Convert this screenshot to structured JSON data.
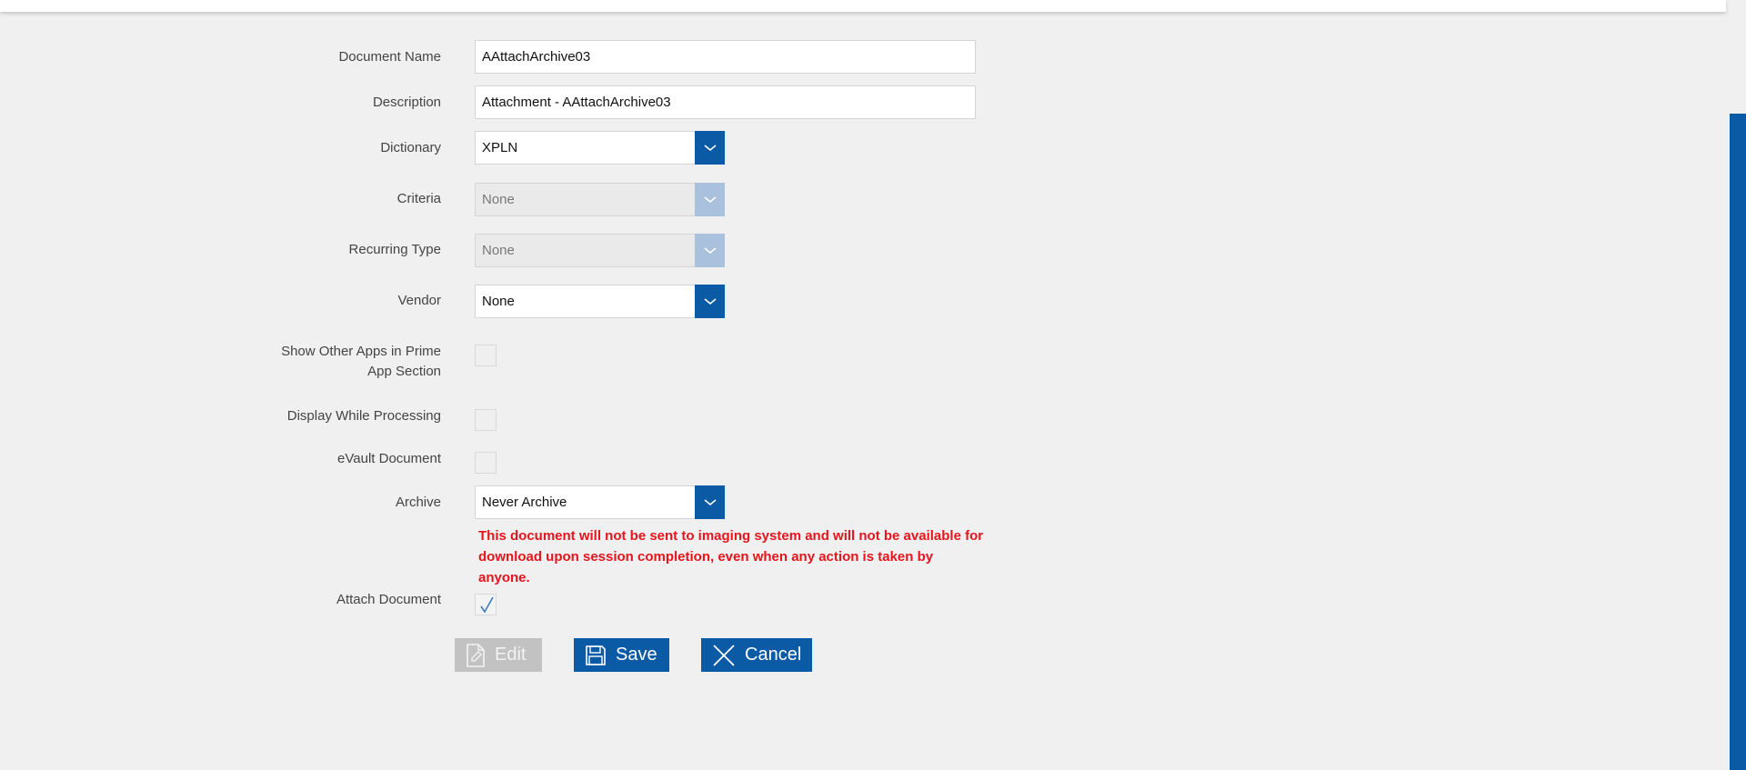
{
  "form": {
    "document_name": {
      "label": "Document Name",
      "value": "AAttachArchive03"
    },
    "description": {
      "label": "Description",
      "value": "Attachment  - AAttachArchive03"
    },
    "dictionary": {
      "label": "Dictionary",
      "value": "XPLN"
    },
    "criteria": {
      "label": "Criteria",
      "value": "None"
    },
    "recurring_type": {
      "label": "Recurring Type",
      "value": "None"
    },
    "vendor": {
      "label": "Vendor",
      "value": "None"
    },
    "show_other_apps": {
      "label_line1": "Show Other Apps in Prime",
      "label_line2": "App Section",
      "checked": false
    },
    "display_while_processing": {
      "label": "Display While Processing",
      "checked": false
    },
    "evault_document": {
      "label": "eVault Document",
      "checked": false
    },
    "archive": {
      "label": "Archive",
      "value": "Never Archive",
      "warning_line1": "This document will not be sent to imaging system and will not be available for",
      "warning_line2": "download upon session completion, even when any action is taken by anyone."
    },
    "attach_document": {
      "label": "Attach Document",
      "checked": true
    }
  },
  "actions": {
    "edit_label": "Edit",
    "save_label": "Save",
    "cancel_label": "Cancel"
  },
  "colors": {
    "accent": "#0a5aa6",
    "warning": "#e8141c",
    "disabled_arrow": "#a9c1dc",
    "disabled_button": "#c2c2c2"
  },
  "icons": {
    "dropdown": "chevron-down-icon",
    "edit": "pencil-document-icon",
    "save": "floppy-disk-icon",
    "cancel": "x-icon",
    "check": "checkmark-icon"
  }
}
